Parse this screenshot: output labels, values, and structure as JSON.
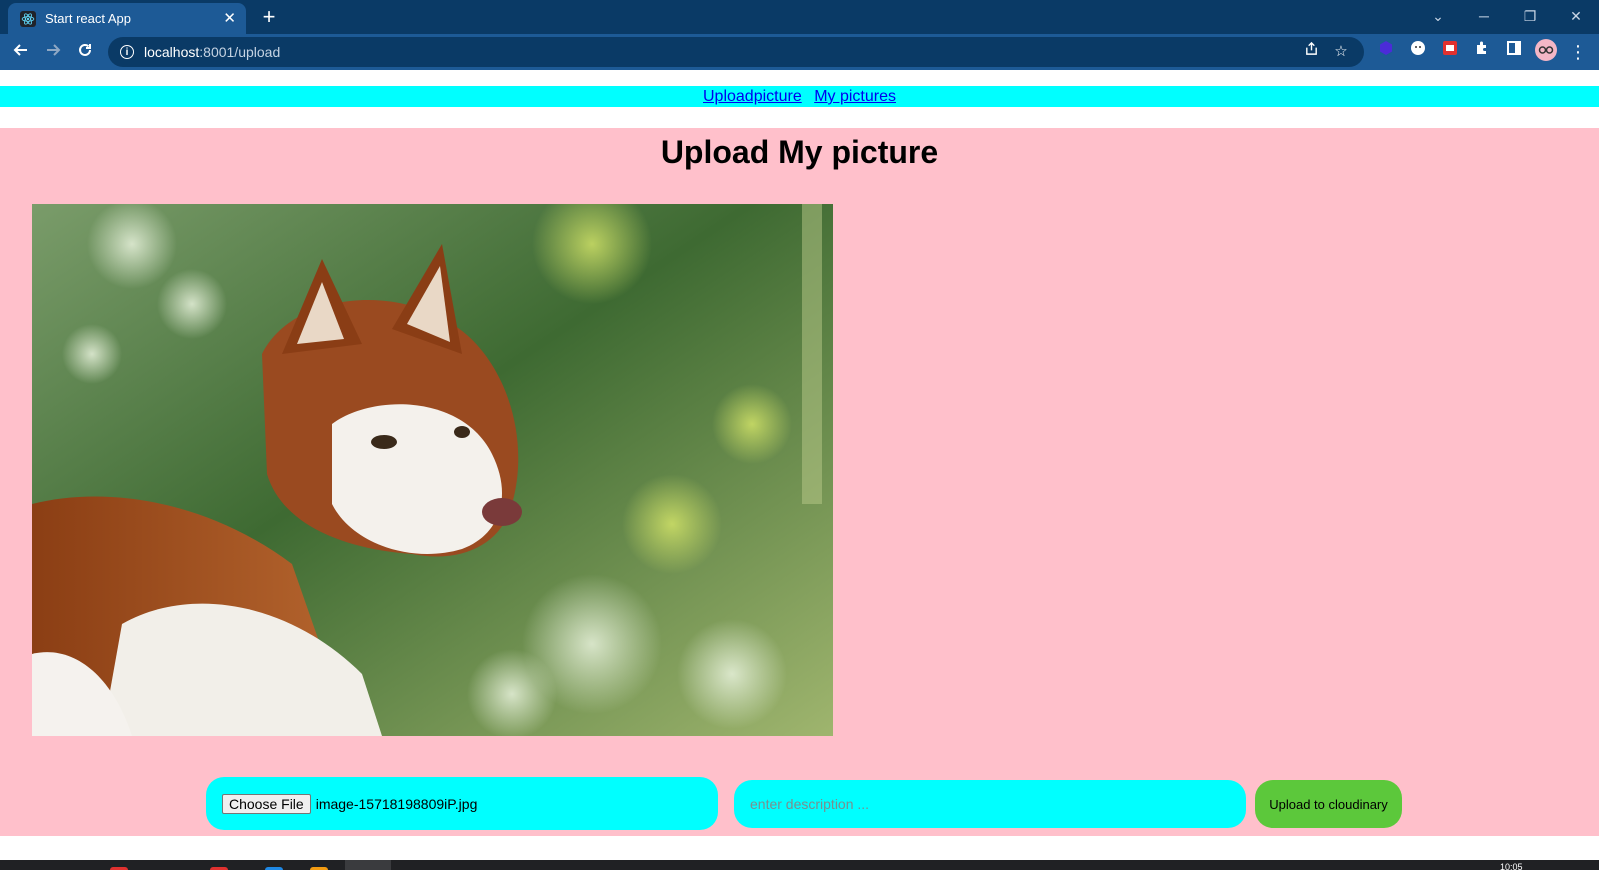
{
  "browser": {
    "tab_title": "Start react App",
    "url_host": "localhost",
    "url_rest": ":8001/upload"
  },
  "nav": {
    "links": [
      "Uploadpicture",
      "My pictures"
    ]
  },
  "page": {
    "heading": "Upload My picture",
    "image_subject": "husky-dog-photo"
  },
  "form": {
    "choose_file_label": "Choose File",
    "selected_file": "image-15718198809iP.jpg",
    "description_placeholder": "enter description ...",
    "submit_label": "Upload to cloudinary"
  },
  "taskbar": {
    "clock": "10:05"
  },
  "colors": {
    "nav_bg": "#00ffff",
    "content_bg": "#ffc0cb",
    "input_bg": "#00ffff",
    "button_bg": "#5cc83b",
    "chrome_dark": "#0a3a66",
    "chrome_light": "#1d5a96"
  }
}
